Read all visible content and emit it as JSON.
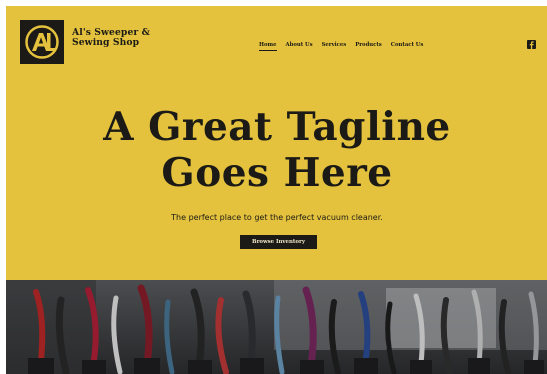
{
  "brand": {
    "line1": "Al's Sweeper &",
    "line2": "Sewing Shop",
    "logo_text": "AL"
  },
  "nav": {
    "items": [
      {
        "label": "Home",
        "active": true
      },
      {
        "label": "About Us"
      },
      {
        "label": "Services"
      },
      {
        "label": "Products"
      },
      {
        "label": "Contact Us"
      }
    ]
  },
  "social": {
    "icon": "facebook-icon"
  },
  "hero": {
    "title_line1": "A Great Tagline",
    "title_line2": "Goes Here",
    "subtitle": "The perfect place to get the perfect vacuum cleaner.",
    "cta_label": "Browse Inventory"
  },
  "colors": {
    "accent": "#e4c23d",
    "dark": "#1b1a16",
    "button_text": "#efe7c8"
  },
  "banner": {
    "image": "store-vacuums-photo"
  }
}
